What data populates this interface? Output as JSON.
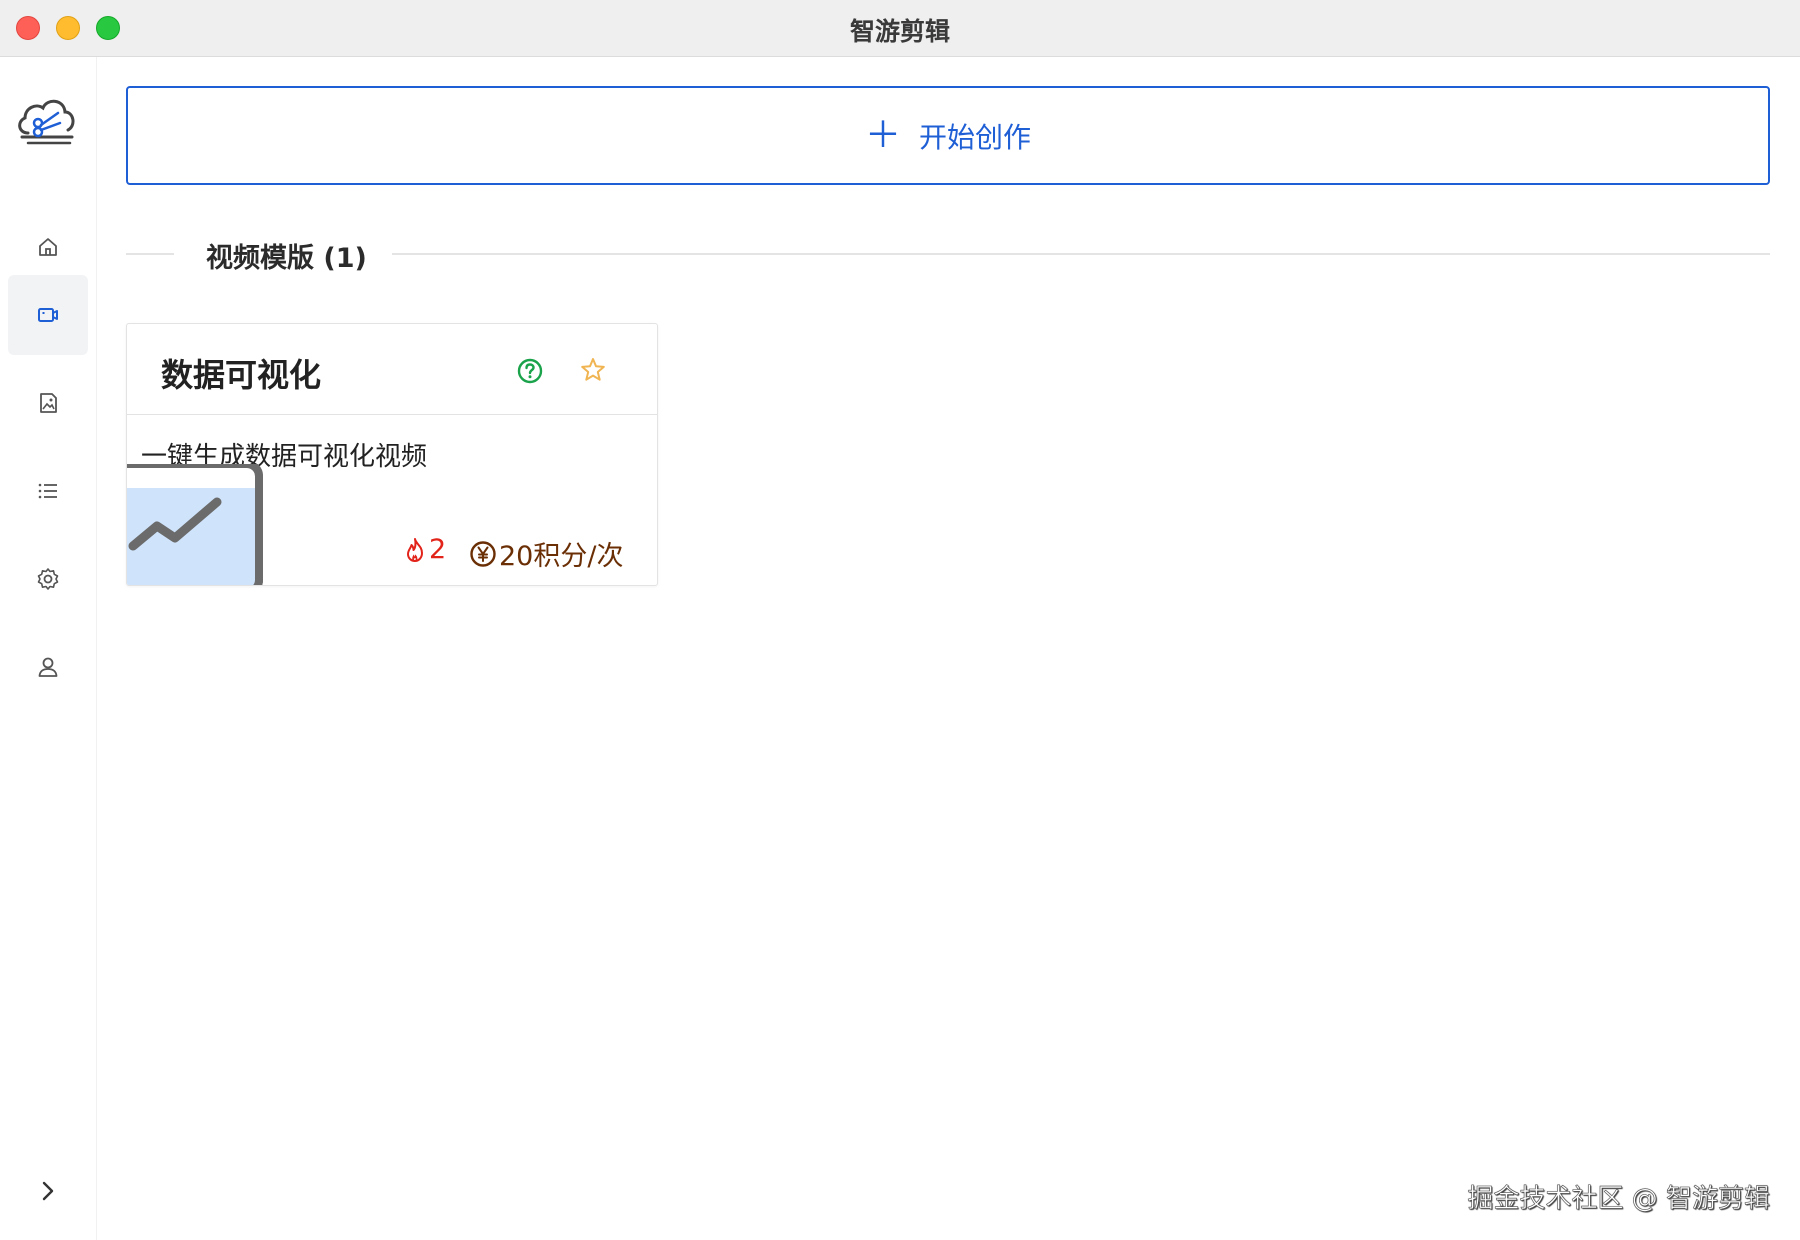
{
  "window": {
    "title": "智游剪辑"
  },
  "sidebar": {
    "items": [
      {
        "icon": "home-icon",
        "active": false
      },
      {
        "icon": "video-icon",
        "active": true
      },
      {
        "icon": "image-icon",
        "active": false
      },
      {
        "icon": "list-icon",
        "active": false
      },
      {
        "icon": "settings-icon",
        "active": false
      },
      {
        "icon": "user-icon",
        "active": false
      }
    ],
    "collapse_icon": "chevron-right-icon"
  },
  "main": {
    "create_button": {
      "icon": "plus-icon",
      "label": "开始创作"
    },
    "section": {
      "title": "视频模版 (1)"
    },
    "templates": [
      {
        "title": "数据可视化",
        "description": "一键生成数据可视化视频",
        "hot_count": "2",
        "price": "20积分/次",
        "icons": [
          "help-circle-icon",
          "star-outline-icon",
          "chart-thumbnail-icon",
          "fire-icon",
          "yen-coin-icon"
        ]
      }
    ]
  },
  "watermark": "掘金技术社区 @ 智游剪辑",
  "colors": {
    "accent": "#1f5fd6",
    "hot": "#e2231a",
    "price": "#6b2f06",
    "help": "#1aa34a",
    "star": "#f0b552",
    "active_nav_bg": "#f2f3f5"
  }
}
